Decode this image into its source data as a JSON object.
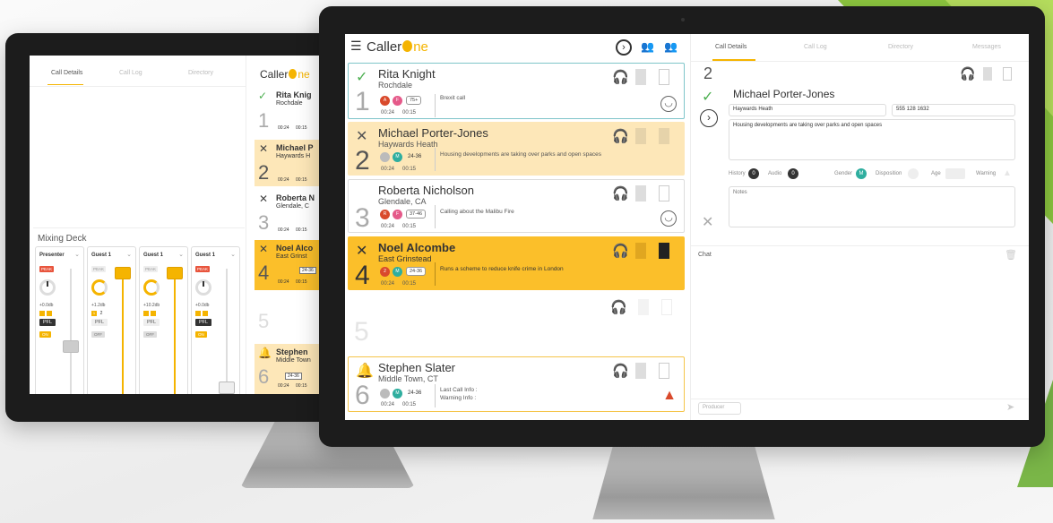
{
  "brand": {
    "name_prefix": "Caller",
    "name_suffix": "ne",
    "accent": "#f5b400"
  },
  "colors": {
    "highlight_bg": "#fde7b8",
    "active_bg": "#fbbf2a",
    "alert": "#d94a2c",
    "green_check": "#4caf50"
  },
  "main": {
    "tabs": [
      "Call Details",
      "Call Log",
      "Directory",
      "Messages"
    ],
    "header_icons": [
      "menu-icon",
      "next-caller-icon",
      "guests-icon",
      "guests-alert-icon"
    ],
    "calls": [
      {
        "num": "1",
        "status": "check",
        "name": "Rita Knight",
        "location": "Rochdale",
        "badges": [
          "A",
          "F"
        ],
        "age": "75+",
        "time_a": "00:24",
        "time_b": "00:15",
        "topic": "Brexit call",
        "mood": "smiley"
      },
      {
        "num": "2",
        "status": "cross",
        "name": "Michael Porter-Jones",
        "location": "Haywards Heath",
        "badges": [
          "",
          "M"
        ],
        "age": "24-36",
        "time_a": "00:24",
        "time_b": "00:15",
        "topic": "Housing developments are taking over parks and open spaces",
        "mood": ""
      },
      {
        "num": "3",
        "status": "",
        "name": "Roberta Nicholson",
        "location": "Glendale, CA",
        "badges": [
          "R",
          "F"
        ],
        "age": "37-46",
        "time_a": "00:24",
        "time_b": "00:15",
        "topic": "Calling about the Malibu Fire",
        "mood": "smiley"
      },
      {
        "num": "4",
        "status": "cross",
        "name": "Noel Alcombe",
        "location": "East Grinstead",
        "badges": [
          "2",
          "M"
        ],
        "age": "24-36",
        "time_a": "00:24",
        "time_b": "00:15",
        "topic": "Runs a scheme to reduce knife crime in London",
        "mood": ""
      },
      {
        "num": "5"
      },
      {
        "num": "6",
        "status": "bell",
        "name": "Stephen Slater",
        "location": "Middle Town, CT",
        "badges": [
          "",
          "M"
        ],
        "age": "24-36",
        "time_a": "00:24",
        "time_b": "00:15",
        "topic": "Last Call Info :",
        "topic2": "Warning Info :",
        "mood": "warning"
      }
    ],
    "details": {
      "line": "2",
      "name": "Michael Porter-Jones",
      "location": "Haywards Heath",
      "phone": "555 128 1632",
      "topic": "Housing developments are taking over parks and open spaces",
      "history_label": "History",
      "history_count": "0",
      "audio_label": "Audio",
      "audio_count": "0",
      "gender_label": "Gender",
      "gender_value": "M",
      "disposition_label": "Disposition",
      "age_label": "Age",
      "warning_label": "Warning",
      "notes_placeholder": "Notes",
      "chat_label": "Chat",
      "chat_input_placeholder": "Producer"
    }
  },
  "left": {
    "tabs": [
      "Call Details",
      "Call Log",
      "Directory"
    ],
    "mixing_title": "Mixing Deck",
    "channels": [
      {
        "label": "Presenter",
        "peak": "PEAK",
        "peak_active": true,
        "db": "+0.0db",
        "flags": [
          "",
          ""
        ],
        "pfl": "PFL",
        "pfl_active": true,
        "on": "ON",
        "on_active": true,
        "level": 0.35,
        "style": "grey"
      },
      {
        "label": "Guest 1",
        "peak": "PEAK",
        "peak_active": false,
        "db": "+1.2db",
        "flags": [
          "1",
          "2"
        ],
        "pfl": "PFL",
        "pfl_active": false,
        "on": "OFF",
        "on_active": false,
        "level": 0.92,
        "style": "yellow"
      },
      {
        "label": "Guest 1",
        "peak": "PEAK",
        "peak_active": false,
        "db": "+10.2db",
        "flags": [
          "",
          ""
        ],
        "pfl": "PFL",
        "pfl_active": false,
        "on": "OFF",
        "on_active": false,
        "level": 0.92,
        "style": "yellow"
      },
      {
        "label": "Guest 1",
        "peak": "PEAK",
        "peak_active": true,
        "db": "+0.0db",
        "flags": [
          "",
          ""
        ],
        "pfl": "PFL",
        "pfl_active": true,
        "on": "ON",
        "on_active": true,
        "level": 0.05,
        "style": "grey"
      }
    ],
    "calls": [
      {
        "num": "1",
        "status": "check",
        "name": "Rita Knig",
        "location": "Rochdale",
        "time_a": "00:24",
        "time_b": "00:15"
      },
      {
        "num": "2",
        "status": "cross",
        "name": "Michael P",
        "location": "Haywards H",
        "time_a": "00:24",
        "time_b": "00:15"
      },
      {
        "num": "3",
        "status": "cross",
        "name": "Roberta N",
        "location": "Glendale, C",
        "time_a": "00:24",
        "time_b": "00:15"
      },
      {
        "num": "4",
        "status": "cross",
        "name": "Noel Alco",
        "location": "East Grinst",
        "time_a": "00:24",
        "time_b": "00:15",
        "age": "24-36"
      },
      {
        "num": "5"
      },
      {
        "num": "6",
        "status": "bell",
        "name": "Stephen",
        "location": "Middle Town",
        "time_a": "00:24",
        "time_b": "00:15",
        "age": "24-36"
      }
    ]
  }
}
